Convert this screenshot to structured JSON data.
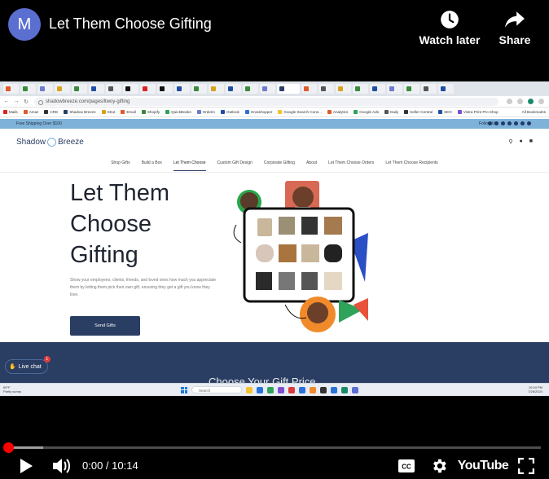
{
  "player": {
    "channel_initial": "M",
    "video_title": "Let Them Choose Gifting",
    "watch_later_label": "Watch later",
    "share_label": "Share",
    "time_current": "0:00",
    "time_total": "10:14",
    "time_separator": " / ",
    "progress_played_fraction": 0.0,
    "progress_loaded_fraction": 0.065,
    "brand_label": "YouTube",
    "cc_label": "CC",
    "accent_color": "#ff0000",
    "avatar_color": "#5b6fd1"
  },
  "browser": {
    "url": "shadowbreeze.com/pages/ltwoy-gifting",
    "bookmarks": [
      "Mails",
      "Amaz",
      "CRE",
      "Shadow Breeze",
      "Strut",
      "Email",
      "Shopify",
      "QuickBooks",
      "Orderin",
      "Outlook",
      "Grasshopper",
      "Google Search Cons...",
      "Analytics",
      "Google Ads",
      "Daily",
      "Seller Central",
      "SEO",
      "Vistra Print Pro Shop"
    ],
    "bookmarks_right": "All Bookmarks"
  },
  "site": {
    "announcement": "Free Shipping Over $100",
    "follow_label": "Follow Us",
    "logo_left": "Shadow",
    "logo_right": "Breeze",
    "nav": [
      "Shop Gifts",
      "Build a Box",
      "Let Them Choose",
      "Custom Gift Design",
      "Corporate Gifting",
      "About",
      "Let Them Choose Orders",
      "Let Them Choose Recipients"
    ],
    "hero_title_lines": [
      "Let Them",
      "Choose",
      "Gifting"
    ],
    "hero_description": "Show your employees, clients, friends, and loved ones how much you appreciate them by letting them pick their own gift, ensuring they get a gift you know they love.",
    "cta_label": "Send Gifts",
    "banner_text": "Choose Your Gift Price",
    "live_chat_label": "Live chat",
    "live_chat_badge": "1",
    "brand_navy": "#2a3d62",
    "announce_blue": "#7fb2d8"
  },
  "taskbar": {
    "weather_temp": "69°F",
    "weather_desc": "Partly sunny",
    "search_placeholder": "Search",
    "time": "10:34 PM",
    "date": "7/26/2024"
  }
}
